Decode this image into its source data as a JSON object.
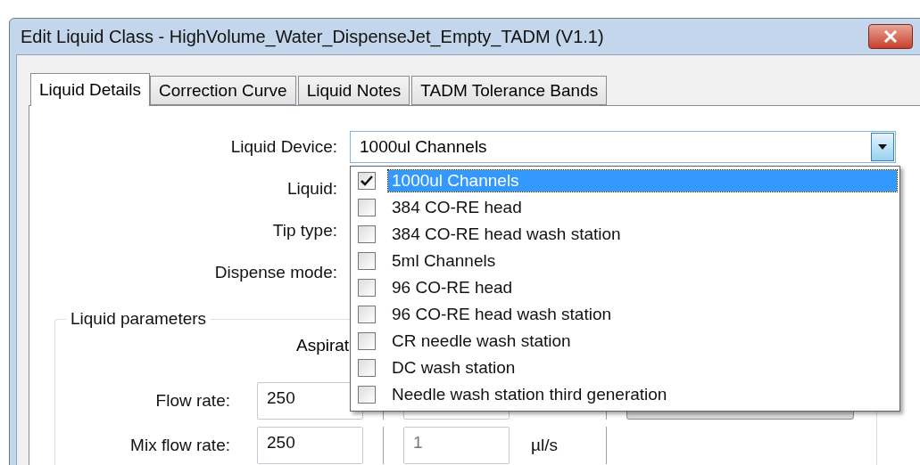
{
  "window": {
    "title": "Edit Liquid Class - HighVolume_Water_DispenseJet_Empty_TADM (V1.1)"
  },
  "tabs": [
    {
      "label": "Liquid Details",
      "selected": true
    },
    {
      "label": "Correction Curve",
      "selected": false
    },
    {
      "label": "Liquid Notes",
      "selected": false
    },
    {
      "label": "TADM Tolerance Bands",
      "selected": false
    }
  ],
  "form": {
    "fields": [
      {
        "label": "Liquid Device:",
        "kind": "combo",
        "value": "1000ul Channels",
        "expanded": true
      },
      {
        "label": "Liquid:",
        "kind": "hidden"
      },
      {
        "label": "Tip type:",
        "kind": "hidden"
      },
      {
        "label": "Dispense mode:",
        "kind": "hidden"
      }
    ]
  },
  "dropdown": {
    "items": [
      {
        "label": "1000ul Channels",
        "checked": true,
        "selected": true
      },
      {
        "label": "384 CO-RE head",
        "checked": false,
        "selected": false
      },
      {
        "label": "384 CO-RE head wash station",
        "checked": false,
        "selected": false
      },
      {
        "label": "5ml Channels",
        "checked": false,
        "selected": false
      },
      {
        "label": "96 CO-RE head",
        "checked": false,
        "selected": false
      },
      {
        "label": "96 CO-RE head wash station",
        "checked": false,
        "selected": false
      },
      {
        "label": "CR needle wash station",
        "checked": false,
        "selected": false
      },
      {
        "label": "DC wash station",
        "checked": false,
        "selected": false
      },
      {
        "label": "Needle wash station third generation",
        "checked": false,
        "selected": false
      }
    ]
  },
  "liquid_parameters": {
    "title": "Liquid parameters",
    "column_heading": "Aspirat",
    "rows": [
      {
        "label": "Flow rate:",
        "value": "250"
      },
      {
        "label": "Mix flow rate:",
        "value": "250",
        "second_value": "1",
        "second_disabled": true,
        "unit": "µl/s"
      }
    ]
  }
}
